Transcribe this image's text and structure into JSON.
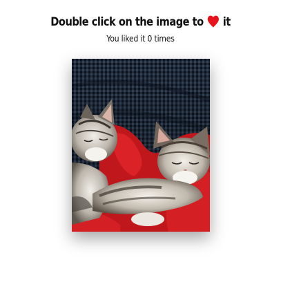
{
  "header": {
    "title_prefix": "Double click on the image to",
    "title_suffix": "it",
    "heart_icon": "heart-icon",
    "heart_color": "#e8141b"
  },
  "counter": {
    "text_prefix": "You liked it",
    "count": 0,
    "text_suffix": "times"
  },
  "image": {
    "subject": "two-sleeping-cats-photo"
  }
}
